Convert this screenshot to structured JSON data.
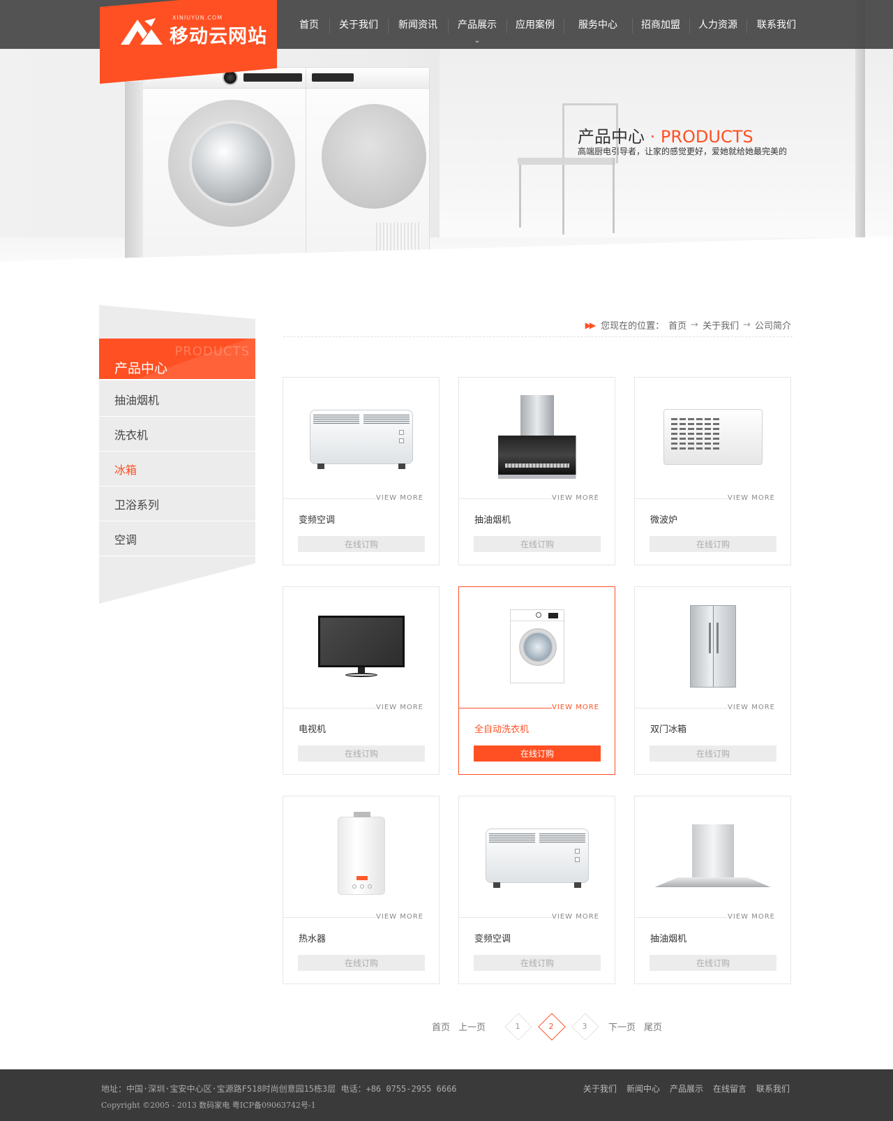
{
  "brand": {
    "domain": "XINIUYUN.COM",
    "name": "移动云网站",
    "accent": "#ff5023"
  },
  "nav": [
    {
      "label": "首页"
    },
    {
      "label": "关于我们"
    },
    {
      "label": "新闻资讯"
    },
    {
      "label": "产品展示",
      "active": true
    },
    {
      "label": "应用案例"
    },
    {
      "label": "服务中心"
    },
    {
      "label": "招商加盟"
    },
    {
      "label": "人力资源"
    },
    {
      "label": "联系我们"
    }
  ],
  "hero": {
    "title_cn": "产品中心",
    "title_sep": " · ",
    "title_en": "PRODUCTS",
    "subtitle": "高端厨电引导者，让家的感觉更好，爱她就给她最完美的"
  },
  "sidebar": {
    "title_en": "PRODUCTS",
    "title_cn": "产品中心",
    "items": [
      {
        "label": "抽油烟机"
      },
      {
        "label": "洗衣机"
      },
      {
        "label": "冰箱",
        "active": true
      },
      {
        "label": "卫浴系列"
      },
      {
        "label": "空调"
      }
    ]
  },
  "breadcrumb": {
    "prefix": "您现在的位置：",
    "items": [
      "首页",
      "关于我们",
      "公司简介"
    ],
    "separator": "→"
  },
  "products": [
    {
      "name": "变频空调",
      "icon": "heater-icon",
      "view_more": "VIEW MORE",
      "buy": "在线订购"
    },
    {
      "name": "抽油烟机",
      "icon": "range-hood-icon",
      "view_more": "VIEW MORE",
      "buy": "在线订购"
    },
    {
      "name": "微波炉",
      "icon": "microwave-icon",
      "view_more": "VIEW MORE",
      "buy": "在线订购"
    },
    {
      "name": "电视机",
      "icon": "tv-icon",
      "view_more": "VIEW MORE",
      "buy": "在线订购"
    },
    {
      "name": "全自动洗衣机",
      "icon": "washing-machine-icon",
      "view_more": "VIEW MORE",
      "buy": "在线订购",
      "active": true
    },
    {
      "name": "双门冰箱",
      "icon": "fridge-icon",
      "view_more": "VIEW MORE",
      "buy": "在线订购"
    },
    {
      "name": "热水器",
      "icon": "water-heater-icon",
      "view_more": "VIEW MORE",
      "buy": "在线订购"
    },
    {
      "name": "变频空调",
      "icon": "heater-icon",
      "view_more": "VIEW MORE",
      "buy": "在线订购"
    },
    {
      "name": "抽油烟机",
      "icon": "island-hood-icon",
      "view_more": "VIEW MORE",
      "buy": "在线订购"
    }
  ],
  "pagination": {
    "first": "首页",
    "prev": "上一页",
    "pages": [
      "1",
      "2",
      "3"
    ],
    "current": "2",
    "next": "下一页",
    "last": "尾页"
  },
  "footer": {
    "address": "地址：中国·深圳·宝安中心区·宝源路F518时尚创意园15栋3层  电话：+86 0755-2955 6666",
    "copyright": "Copyright ©2005 - 2013 数码家电 粤ICP备09063742号-1",
    "links": [
      "关于我们",
      "新闻中心",
      "产品展示",
      "在线留言",
      "联系我们"
    ]
  }
}
